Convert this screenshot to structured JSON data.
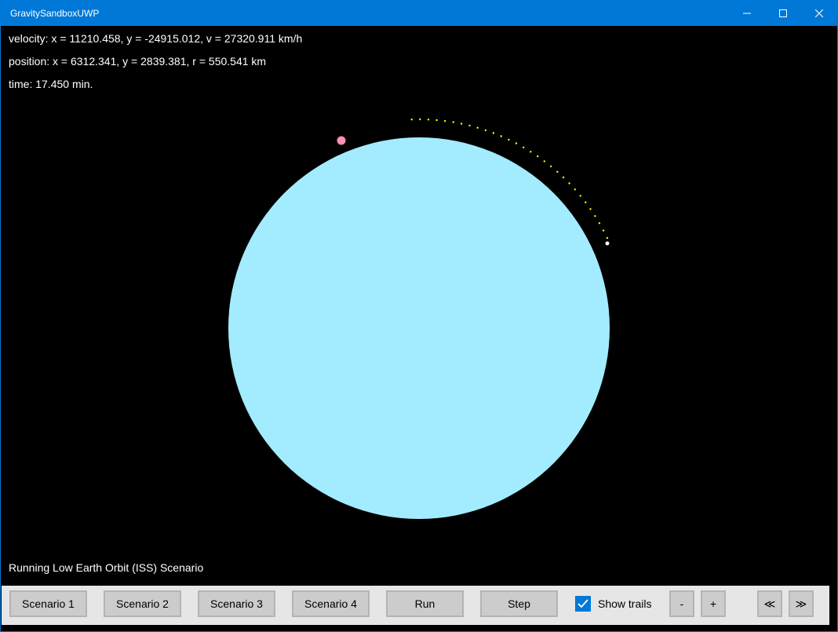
{
  "window": {
    "title": "GravitySandboxUWP",
    "accent_color": "#0078d7"
  },
  "readouts": {
    "velocity": "velocity: x = 11210.458, y = -24915.012, v = 27320.911 km/h",
    "position": "position: x = 6312.341, y = 2839.381, r = 550.541 km",
    "time": "time: 17.450 min."
  },
  "scene": {
    "background_color": "#000000",
    "earth_color": "#a3ecff",
    "satellite_color": "#ffffff",
    "trail_color": "#ffff00",
    "moon_color": "#ff8fb8"
  },
  "status": "Running Low Earth Orbit (ISS) Scenario",
  "toolbar": {
    "scenario1": "Scenario 1",
    "scenario2": "Scenario 2",
    "scenario3": "Scenario 3",
    "scenario4": "Scenario 4",
    "run": "Run",
    "step": "Step",
    "show_trails_label": "Show trails",
    "show_trails_checked": true,
    "zoom_out": "-",
    "zoom_in": "+",
    "slower": "≪",
    "faster": "≫"
  }
}
